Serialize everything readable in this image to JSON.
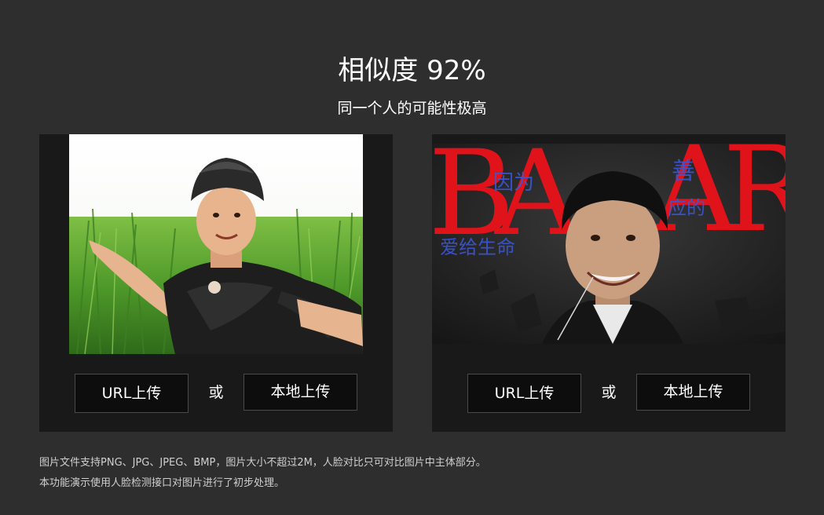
{
  "result": {
    "title": "相似度 92%",
    "subtitle": "同一个人的可能性极高"
  },
  "panels": [
    {
      "url_label": "URL上传",
      "or_label": "或",
      "local_label": "本地上传"
    },
    {
      "url_label": "URL上传",
      "or_label": "或",
      "local_label": "本地上传"
    }
  ],
  "notes": [
    "图片文件支持PNG、JPG、JPEG、BMP，图片大小不超过2M，人脸对比只可对比图片中主体部分。",
    "本功能演示使用人脸检测接口对图片进行了初步处理。"
  ],
  "colors": {
    "background": "#2e2e2e",
    "panel": "#191919",
    "button": "#0d0d0d",
    "magazine_red": "#e0131a",
    "magazine_blue": "#3a57d6"
  },
  "magazine_letters": [
    "B",
    "A",
    "A",
    "R"
  ],
  "magazine_overlay_text": [
    "因为",
    "爱给生命",
    "善",
    "应的"
  ]
}
